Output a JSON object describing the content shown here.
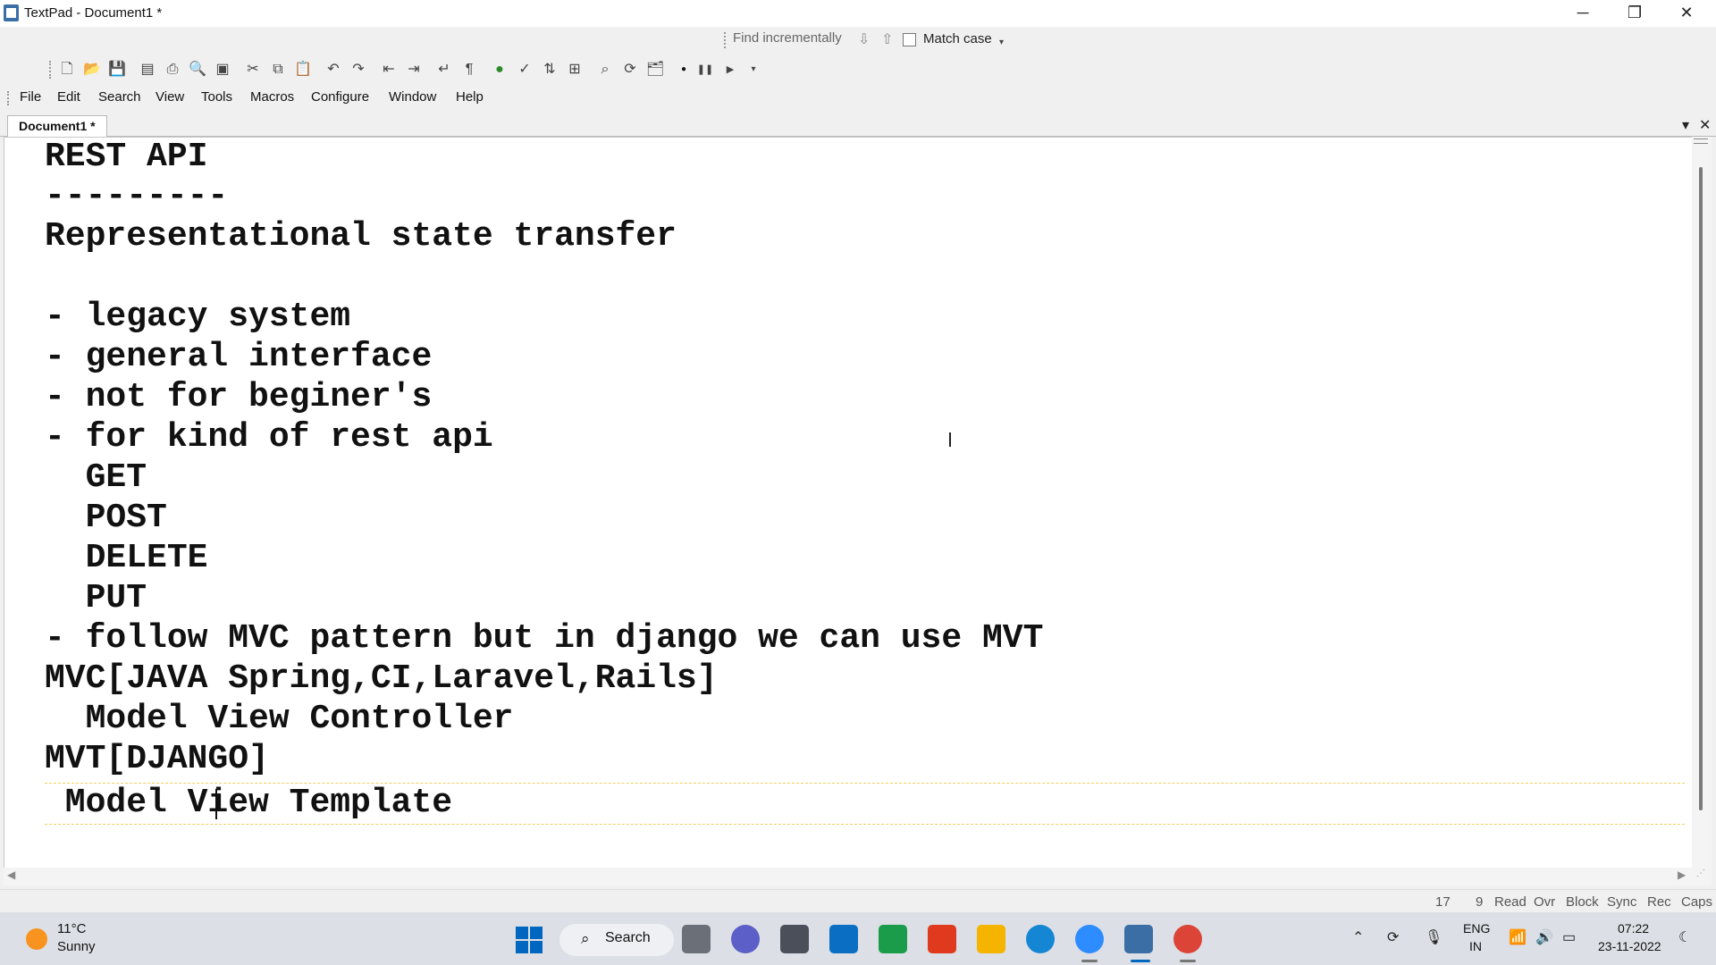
{
  "window": {
    "title": "TextPad - Document1 *",
    "min_glyph": "─",
    "restore_glyph": "❐",
    "close_glyph": "✕"
  },
  "findbar": {
    "placeholder": "Find incrementally",
    "down_glyph": "⇩",
    "up_glyph": "⇧",
    "match_case_label": "Match case",
    "match_case_checked": false
  },
  "toolbar": {
    "icons": [
      "new-icon",
      "open-icon",
      "save-icon",
      "save-all-icon",
      "print-icon",
      "print-preview-icon",
      "page-setup-icon",
      "cut-icon",
      "copy-icon",
      "paste-icon",
      "undo-icon",
      "redo-icon",
      "outdent-icon",
      "indent-icon",
      "word-wrap-icon",
      "show-paragraph-icon",
      "browser-icon",
      "spelling-icon",
      "sort-icon",
      "compare-icon",
      "find-icon",
      "replace-icon",
      "find-in-files-icon",
      "record-macro-icon",
      "pause-macro-icon",
      "play-macro-icon"
    ]
  },
  "menu": {
    "items": [
      "File",
      "Edit",
      "Search",
      "View",
      "Tools",
      "Macros",
      "Configure",
      "Window",
      "Help"
    ]
  },
  "tab": {
    "label": "Document1 *",
    "list_glyph": "▾",
    "close_glyph": "✕"
  },
  "editor": {
    "lines": [
      "REST API",
      "---------",
      "Representational state transfer",
      "",
      "- legacy system",
      "- general interface",
      "- not for beginer's",
      "- for kind of rest api",
      "  GET",
      "  POST",
      "  DELETE",
      "  PUT",
      "- follow MVC pattern but in django we can use MVT",
      "MVC[JAVA Spring,CI,Laravel,Rails]",
      "  Model View Controller",
      "MVT[DJANGO]",
      " Model View Template"
    ],
    "cursor_line": 17,
    "cursor_col": 9
  },
  "status": {
    "line": "17",
    "col": "9",
    "read": "Read",
    "ovr": "Ovr",
    "block": "Block",
    "sync": "Sync",
    "rec": "Rec",
    "caps": "Caps"
  },
  "taskbar": {
    "weather_temp": "11°C",
    "weather_condition": "Sunny",
    "search_label": "Search",
    "apps": [
      "task-view-icon",
      "teams-chat-icon",
      "camera-icon",
      "vscode-icon",
      "pycharm-icon",
      "office-icon",
      "file-explorer-icon",
      "edge-icon",
      "zoom-icon",
      "textpad-icon",
      "chrome-icon"
    ],
    "lang_top": "ENG",
    "lang_bottom": "IN",
    "time": "07:22",
    "date": "23-11-2022",
    "colors": {
      "start": "#0067c0",
      "weather": "#f7931e"
    }
  }
}
